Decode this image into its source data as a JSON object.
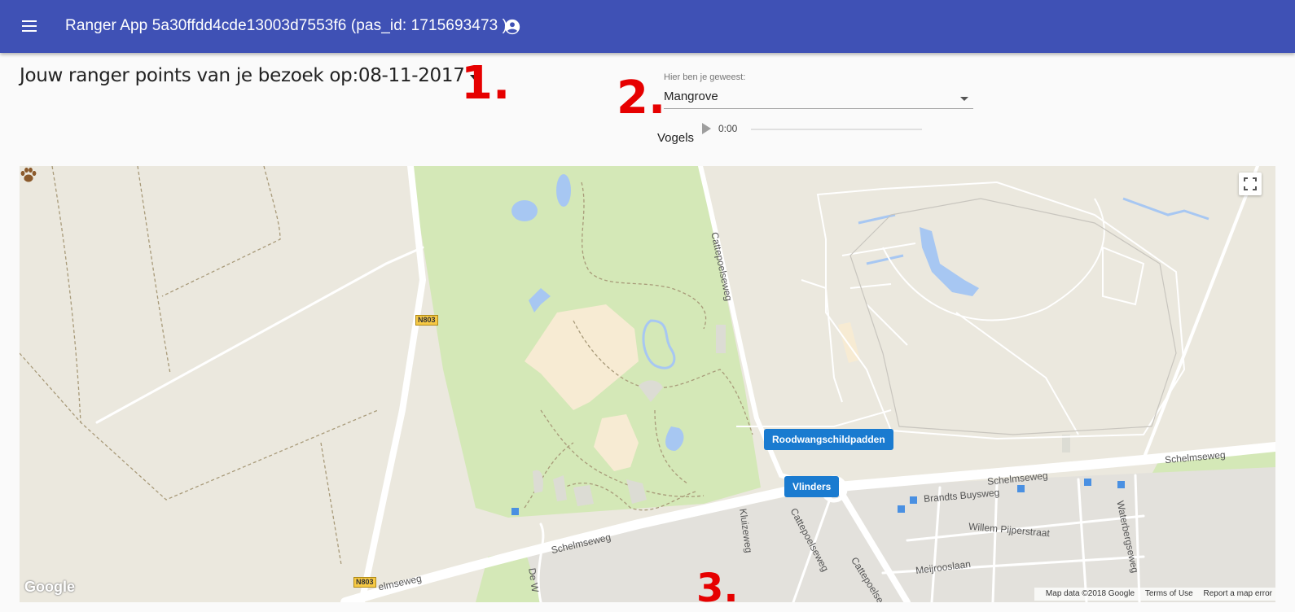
{
  "appbar": {
    "title": "Ranger App 5a30ffdd4cde13003d7553f6 (pas_id: 1715693473 )",
    "color": "#3f51b5"
  },
  "visit": {
    "heading": "Jouw ranger points van je bezoek op:08-11-2017"
  },
  "annotations": [
    "1.",
    "2.",
    "3."
  ],
  "location_select": {
    "label": "Hier ben je geweest:",
    "value": "Mangrove"
  },
  "audio": {
    "label": "Vogels",
    "time": "0:00"
  },
  "map": {
    "markers": [
      {
        "label": "Roodwangschildpadden",
        "icon": "paw-icon"
      },
      {
        "label": "Vlinders",
        "icon": "paw-icon"
      }
    ],
    "roads": {
      "cattepoelseweg": "Cattepoelseweg",
      "schelmseweg_1": "Schelmseweg",
      "schelmseweg_2": "Schelmseweg",
      "schelmseweg_3": "Schelmseweg",
      "brandts": "Brandts Buysweg",
      "willem": "Willem Pijperstraat",
      "meijroos": "Meijrooslaan",
      "waterberg": "Waterbergseweg",
      "kluizeweg": "Kluizeweg",
      "cattepoelseweg_2": "Cattepoelseweg",
      "cattepoelseweg_3": "Cattepoelse",
      "de_w": "De W",
      "elmseweg": "elmseweg"
    },
    "shields": [
      "N803",
      "N803"
    ],
    "logo": "Google",
    "attribution": "Map data ©2018 Google",
    "terms": "Terms of Use",
    "report": "Report a map error",
    "colors": {
      "land": "#ebe8de",
      "park": "#d4e8b7",
      "water": "#a7c7f2",
      "road": "#ffffff",
      "marker": "#1a7bd0"
    }
  }
}
